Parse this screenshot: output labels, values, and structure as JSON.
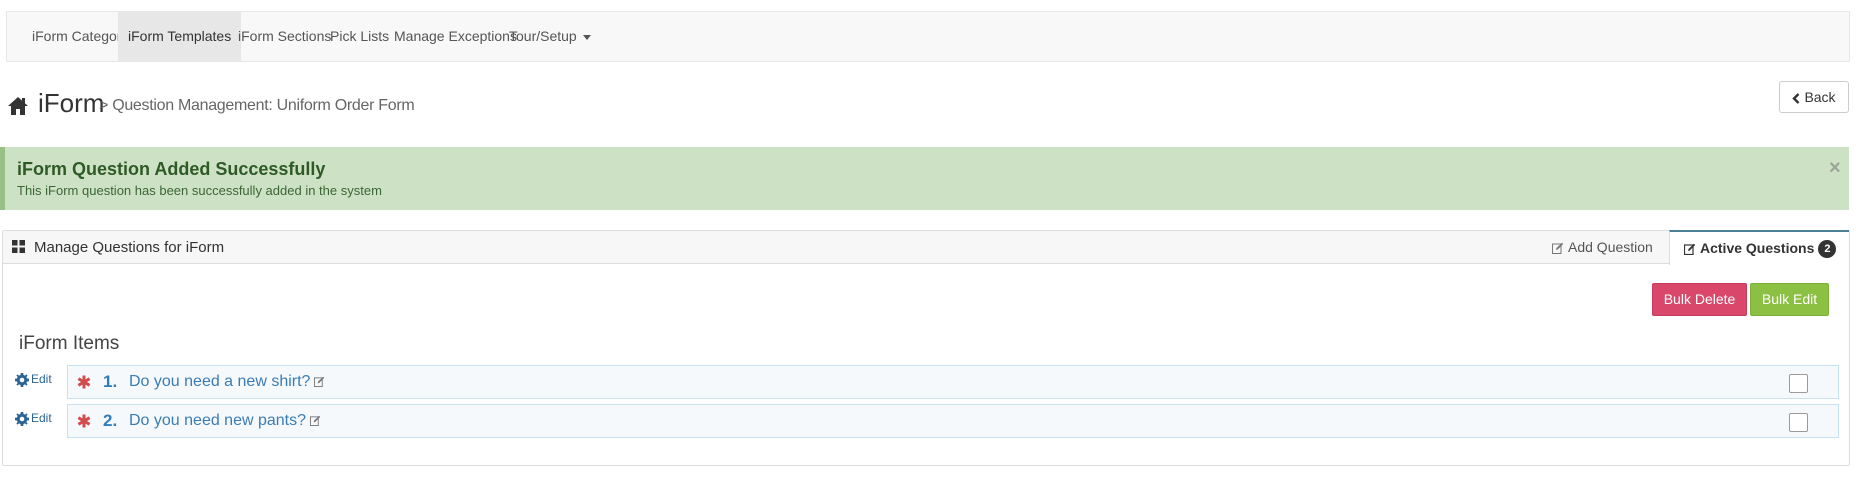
{
  "nav": {
    "items": [
      {
        "label": "iForm Categories",
        "active": false
      },
      {
        "label": "iForm Templates",
        "active": true
      },
      {
        "label": "iForm Sections",
        "active": false
      },
      {
        "label": "Pick Lists",
        "active": false
      },
      {
        "label": "Manage Exceptions",
        "active": false
      },
      {
        "label": "Tour/Setup",
        "active": false,
        "dropdown": true
      }
    ]
  },
  "header": {
    "title": "iForm",
    "subtitle": "> Question Management: Uniform Order Form",
    "back_label": "Back"
  },
  "alert": {
    "title": "iForm Question Added Successfully",
    "text": "This iForm question has been successfully added in the system",
    "close": "×",
    "color": "#cde2c5"
  },
  "panel": {
    "title": "Manage Questions for iForm",
    "tabs": {
      "add_question": "Add Question",
      "active_questions": "Active Questions",
      "active_count": "2"
    },
    "bulk_delete_label": "Bulk Delete",
    "bulk_edit_label": "Bulk Edit",
    "section_heading": "iForm Items",
    "questions": [
      {
        "edit_label": "Edit",
        "number": "1.",
        "text": "Do you need a new shirt?",
        "required": true,
        "checked": false
      },
      {
        "edit_label": "Edit",
        "number": "2.",
        "text": "Do you need new pants?",
        "required": true,
        "checked": false
      }
    ]
  },
  "colors": {
    "danger": "#d9486a",
    "success": "#8cc043",
    "link": "#2a6496",
    "required": "#d24c4c"
  }
}
